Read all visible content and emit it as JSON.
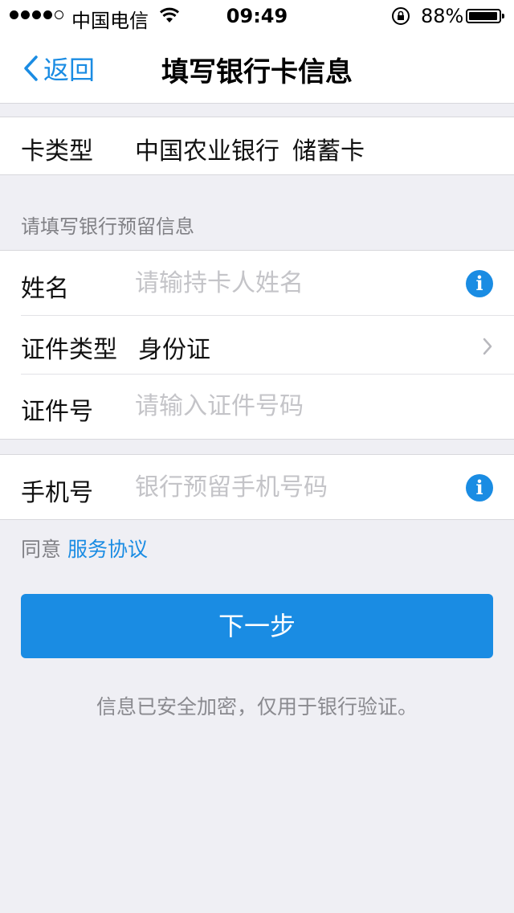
{
  "status_bar": {
    "carrier": "中国电信",
    "time": "09:49",
    "battery": "88%",
    "battery_level": 0.88
  },
  "nav": {
    "back_label": "返回",
    "title": "填写银行卡信息"
  },
  "card": {
    "label": "卡类型",
    "bank": "中国农业银行",
    "type": "储蓄卡"
  },
  "section_header": "请填写银行预留信息",
  "form": {
    "name_label": "姓名",
    "name_placeholder": "请输持卡人姓名",
    "id_type_label": "证件类型",
    "id_type_value": "身份证",
    "id_number_label": "证件号",
    "id_number_placeholder": "请输入证件号码",
    "phone_label": "手机号",
    "phone_placeholder": "银行预留手机号码"
  },
  "agreement": {
    "prefix": "同意",
    "link": "服务协议"
  },
  "next_button": "下一步",
  "footnote": "信息已安全加密，仅用于银行验证。",
  "colors": {
    "accent": "#1a8ce3",
    "background": "#efeff4",
    "placeholder": "#c4c4c8"
  },
  "icons": [
    "signal-dots-icon",
    "wifi-icon",
    "rotation-lock-icon",
    "battery-icon",
    "back-chevron-icon",
    "info-icon",
    "chevron-right-icon"
  ]
}
